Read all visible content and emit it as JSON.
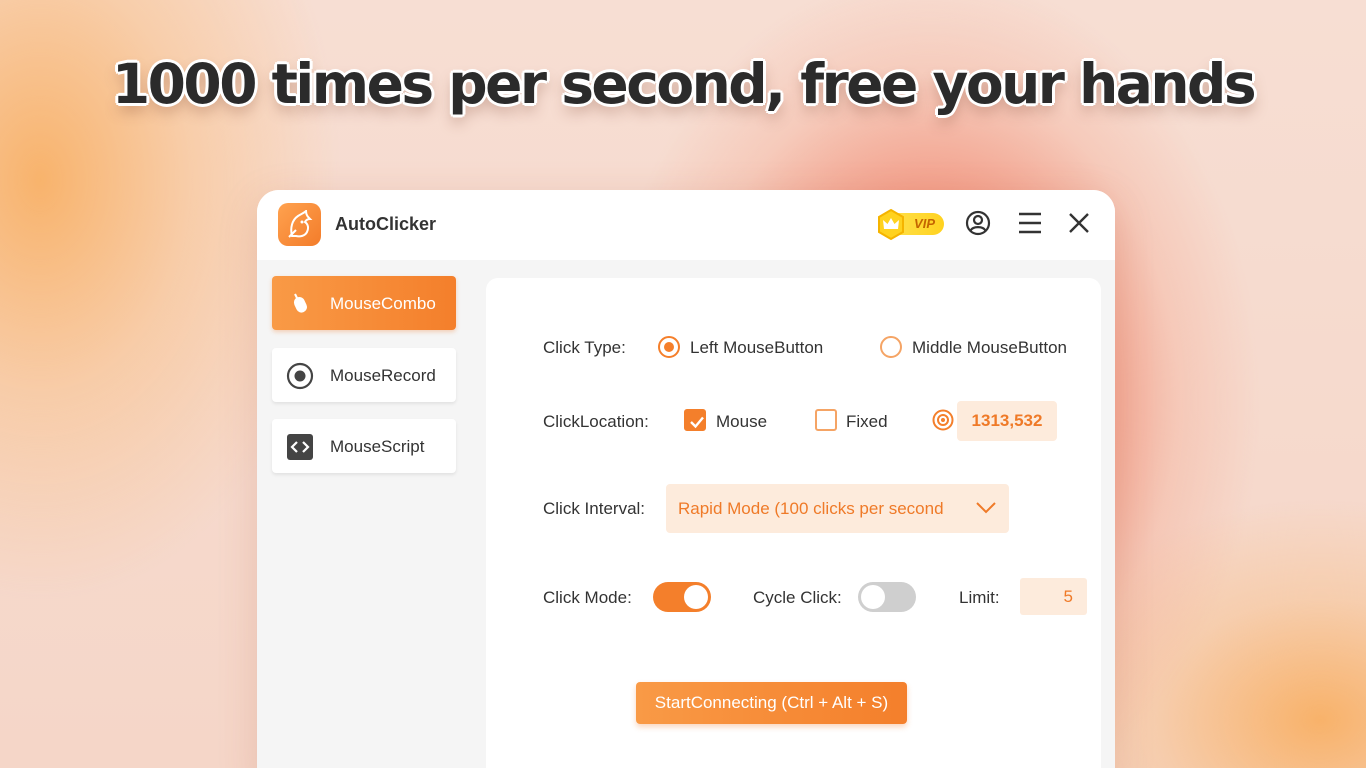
{
  "headline": "1000 times per second, free your hands",
  "app": {
    "title": "AutoClicker",
    "vip_label": "VIP"
  },
  "sidebar": {
    "items": [
      {
        "label": "MouseCombo",
        "icon": "mouse-icon",
        "active": true
      },
      {
        "label": "MouseRecord",
        "icon": "record-icon",
        "active": false
      },
      {
        "label": "MouseScript",
        "icon": "code-icon",
        "active": false
      }
    ]
  },
  "settings": {
    "click_type": {
      "label": "Click Type:",
      "options": [
        "Left MouseButton",
        "Middle MouseButton"
      ],
      "selected": "Left MouseButton"
    },
    "click_location": {
      "label": "ClickLocation:",
      "mouse_label": "Mouse",
      "mouse_checked": true,
      "fixed_label": "Fixed",
      "fixed_checked": false,
      "coordinates": "1313,532"
    },
    "click_interval": {
      "label": "Click Interval:",
      "value": "Rapid Mode (100 clicks per second"
    },
    "click_mode": {
      "label": "Click Mode:",
      "on": true
    },
    "cycle_click": {
      "label": "Cycle Click:",
      "on": false
    },
    "limit": {
      "label": "Limit:",
      "value": "5"
    }
  },
  "start_button": "StartConnecting (Ctrl + Alt + S)",
  "colors": {
    "accent": "#f47f2b",
    "accent_light": "#fdebdc",
    "toggle_off": "#cfcfcf"
  }
}
